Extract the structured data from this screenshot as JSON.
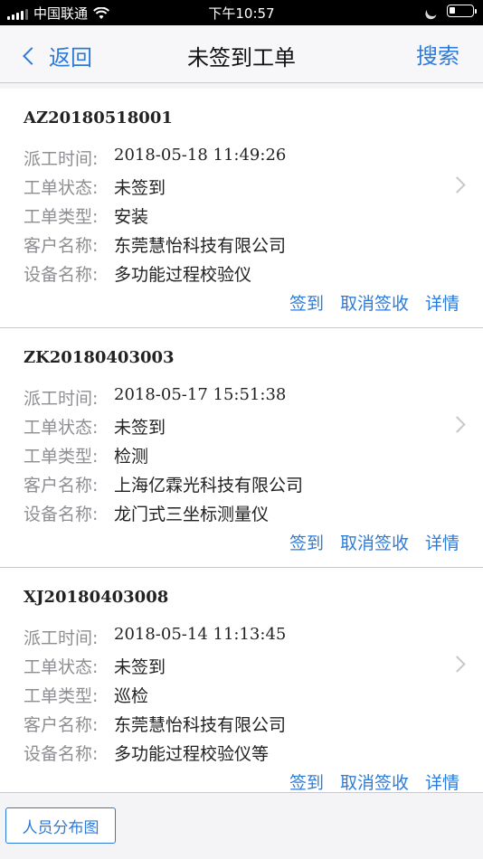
{
  "status_bar": {
    "carrier": "中国联通",
    "time": "下午10:57",
    "battery_level": 0.25
  },
  "nav": {
    "back_label": "返回",
    "title": "未签到工单",
    "search_label": "搜索"
  },
  "labels": {
    "dispatch_time": "派工时间:",
    "status": "工单状态:",
    "type": "工单类型:",
    "customer": "客户名称:",
    "device": "设备名称:"
  },
  "actions": {
    "sign_in": "签到",
    "cancel_receipt": "取消签收",
    "details": "详情"
  },
  "orders": [
    {
      "order_no": "AZ20180518001",
      "dispatch_time": "2018-05-18 11:49:26",
      "status": "未签到",
      "type": "安装",
      "customer": "东莞慧怡科技有限公司",
      "device": "多功能过程校验仪"
    },
    {
      "order_no": "ZK20180403003",
      "dispatch_time": "2018-05-17 15:51:38",
      "status": "未签到",
      "type": "检测",
      "customer": "上海亿霖光科技有限公司",
      "device": "龙门式三坐标测量仪"
    },
    {
      "order_no": "XJ20180403008",
      "dispatch_time": "2018-05-14 11:13:45",
      "status": "未签到",
      "type": "巡检",
      "customer": "东莞慧怡科技有限公司",
      "device": "多功能过程校验仪等"
    }
  ],
  "bottom": {
    "staff_map_label": "人员分布图"
  }
}
